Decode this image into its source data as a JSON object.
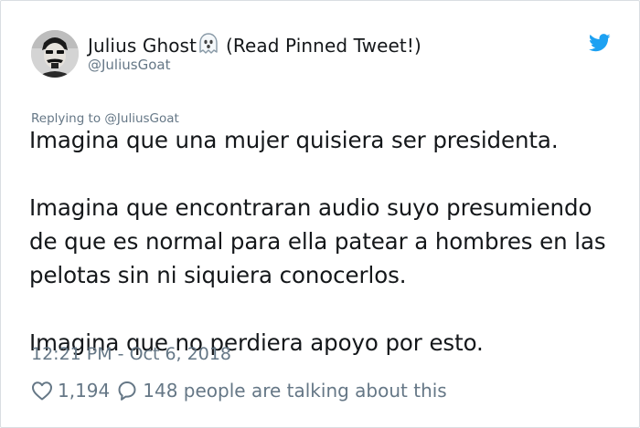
{
  "author": {
    "display_name": "Julius Ghost",
    "name_suffix": "(Read Pinned Tweet!)",
    "handle": "@JuliusGoat",
    "name_emoji": "ghost-icon"
  },
  "reply_context": "Replying to @JuliusGoat",
  "tweet": {
    "paragraphs": [
      [
        "Imagina que una mujer quisiera ser presidenta."
      ],
      [
        "Imagina que encontraran audio suyo presumiendo",
        "de que es normal para ella patear a hombres en las",
        "pelotas sin ni siquiera conocerlos."
      ],
      [
        "Imagina que no perdiera apoyo por esto."
      ]
    ]
  },
  "timestamp": "12:21 PM - Oct 6, 2018",
  "actions": {
    "like_count": "1,194",
    "reply_text": "148 people are talking about this"
  },
  "icons": {
    "brand": "twitter-bird-icon",
    "like": "heart-icon",
    "reply": "speech-bubble-icon"
  },
  "colors": {
    "text": "#14171a",
    "secondary": "#657786",
    "brand_blue": "#1da1f2",
    "border": "#d9dee2"
  }
}
